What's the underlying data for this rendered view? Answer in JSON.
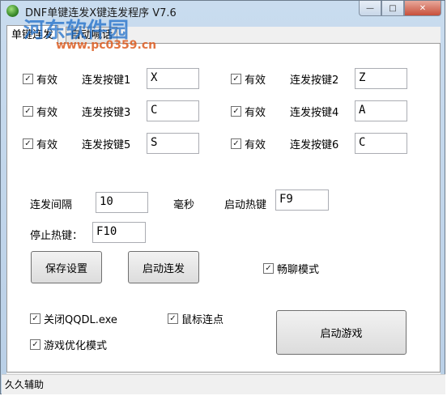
{
  "window": {
    "title": "DNF单键连发X键连发程序 V7.6"
  },
  "tabs": [
    {
      "label": "单键连发"
    },
    {
      "label": "自动喊话"
    }
  ],
  "keys": [
    {
      "enabled_label": "有效",
      "label": "连发按键1",
      "value": "X"
    },
    {
      "enabled_label": "有效",
      "label": "连发按键2",
      "value": "Z"
    },
    {
      "enabled_label": "有效",
      "label": "连发按键3",
      "value": "C"
    },
    {
      "enabled_label": "有效",
      "label": "连发按键4",
      "value": "A"
    },
    {
      "enabled_label": "有效",
      "label": "连发按键5",
      "value": "S"
    },
    {
      "enabled_label": "有效",
      "label": "连发按键6",
      "value": "C"
    }
  ],
  "interval": {
    "label": "连发间隔",
    "value": "10",
    "unit": "毫秒"
  },
  "start_hotkey": {
    "label": "启动热键",
    "value": "F9"
  },
  "stop_hotkey": {
    "label": "停止热键：",
    "value": "F10"
  },
  "buttons": {
    "save": "保存设置",
    "start_repeat": "启动连发",
    "start_game": "启动游戏"
  },
  "options": {
    "smooth_chat": "畅聊模式",
    "close_qqdl": "关闭QQDL.exe",
    "mouse_click": "鼠标连点",
    "game_optimize": "游戏优化模式"
  },
  "status": {
    "text": "久久辅助"
  },
  "watermark": {
    "text": "河东软件园",
    "url": "www.pc0359.cn"
  }
}
